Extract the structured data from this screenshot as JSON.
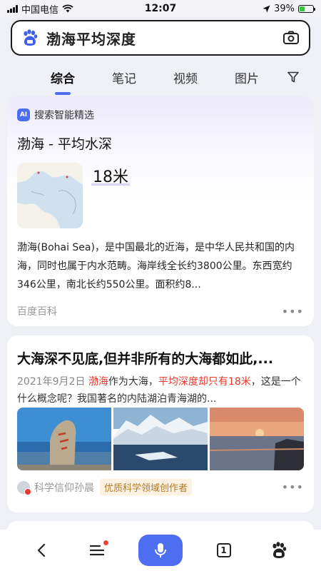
{
  "status_bar": {
    "carrier": "中国电信",
    "time": "12:07",
    "battery_percent": "39%",
    "battery_level": 0.39
  },
  "search": {
    "query": "渤海平均深度"
  },
  "tabs": [
    {
      "label": "综合",
      "active": true
    },
    {
      "label": "笔记",
      "active": false
    },
    {
      "label": "视频",
      "active": false
    },
    {
      "label": "图片",
      "active": false
    }
  ],
  "ai_card": {
    "badge": "AI",
    "header": "搜索智能精选",
    "title": "渤海 - 平均水深",
    "answer": "18米",
    "description": "渤海(Bohai Sea)，是中国最北的近海，是中华人民共和国的内海，同时也属于内水范畴。海岸线全长约3800公里。东西宽约346公里，南北长约550公里。面积约8...",
    "source": "百度百科"
  },
  "result_card": {
    "title": "大海深不见底,但并非所有的大海都如此,...",
    "date": "2021年9月2日",
    "snippet_hl_1": "渤海",
    "snippet_part_1": "作为大海，",
    "snippet_hl_2": "平均深度却只有18米",
    "snippet_part_2": "，这是一个什么概念呢？我国著名的内陆湖泊青海湖的...",
    "author": "科学信仰孙晨",
    "author_tag": "优质科学领域创作者"
  },
  "bottom_bar": {
    "tab_count": "1"
  },
  "colors": {
    "accent": "#4e6ef2",
    "highlight_red": "#e63a2e",
    "battery_green": "#3ec244"
  },
  "icons": [
    "wifi-icon",
    "location-arrow-icon",
    "battery-icon",
    "baidu-paw-icon",
    "camera-icon",
    "filter-icon",
    "back-icon",
    "menu-icon",
    "mic-icon",
    "tabs-icon",
    "baidu-home-icon"
  ]
}
